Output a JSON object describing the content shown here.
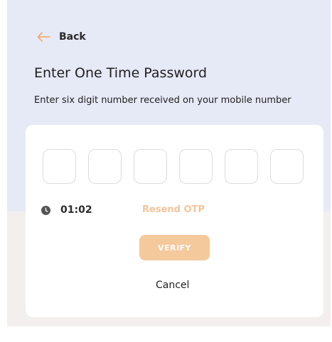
{
  "header": {
    "back_label": "Back",
    "title": "Enter One Time Password",
    "subtitle": "Enter six digit number received on your mobile number"
  },
  "otp": {
    "digit_count": 6,
    "digits": [
      "",
      "",
      "",
      "",
      "",
      ""
    ]
  },
  "timer": {
    "value": "01:02",
    "icon": "clock-icon"
  },
  "actions": {
    "resend_label": "Resend OTP",
    "verify_label": "VERIFY",
    "cancel_label": "Cancel"
  },
  "colors": {
    "accent": "#f2a65a",
    "accent_disabled": "#f4c99b",
    "top_background": "#e6e9f6",
    "bottom_background": "#f3efee"
  }
}
